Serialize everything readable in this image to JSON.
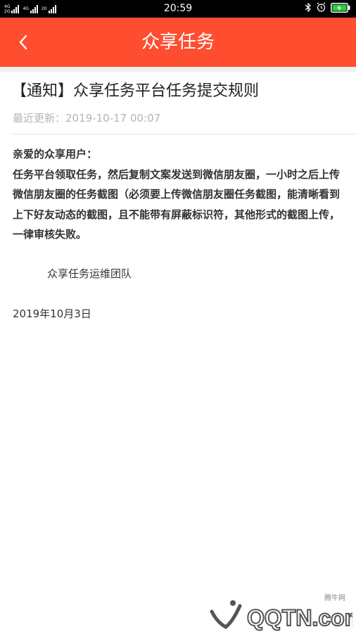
{
  "status_bar": {
    "time": "20:59",
    "sim1": "4G",
    "sim2": "4G",
    "sim3": "2G",
    "data_rate": "20",
    "icons": [
      "bluetooth-icon",
      "alarm-icon",
      "battery-charging-icon"
    ],
    "battery_color": "#2ecc40"
  },
  "header": {
    "title": "众享任务",
    "back_icon": "chevron-left-icon",
    "color": "#fe4e2f"
  },
  "article": {
    "title": "【通知】众享任务平台任务提交规则",
    "updated_label": "最近更新：",
    "updated_value": "2019-10-17 00:07",
    "greeting": "亲爱的众享用户：",
    "body": "任务平台领取任务，然后复制文案发送到微信朋友圈，一小时之后上传微信朋友圈的任务截图（必须要上传微信朋友圈任务截图，能清晰看到上下好友动态的截图，且不能带有屏蔽标识符，其他形式的截图上传，一律审核失败。",
    "signature": "众享任务运维团队",
    "date": "2019年10月3日"
  },
  "watermark": {
    "name": "腾牛网",
    "text": "QQTN.com"
  }
}
